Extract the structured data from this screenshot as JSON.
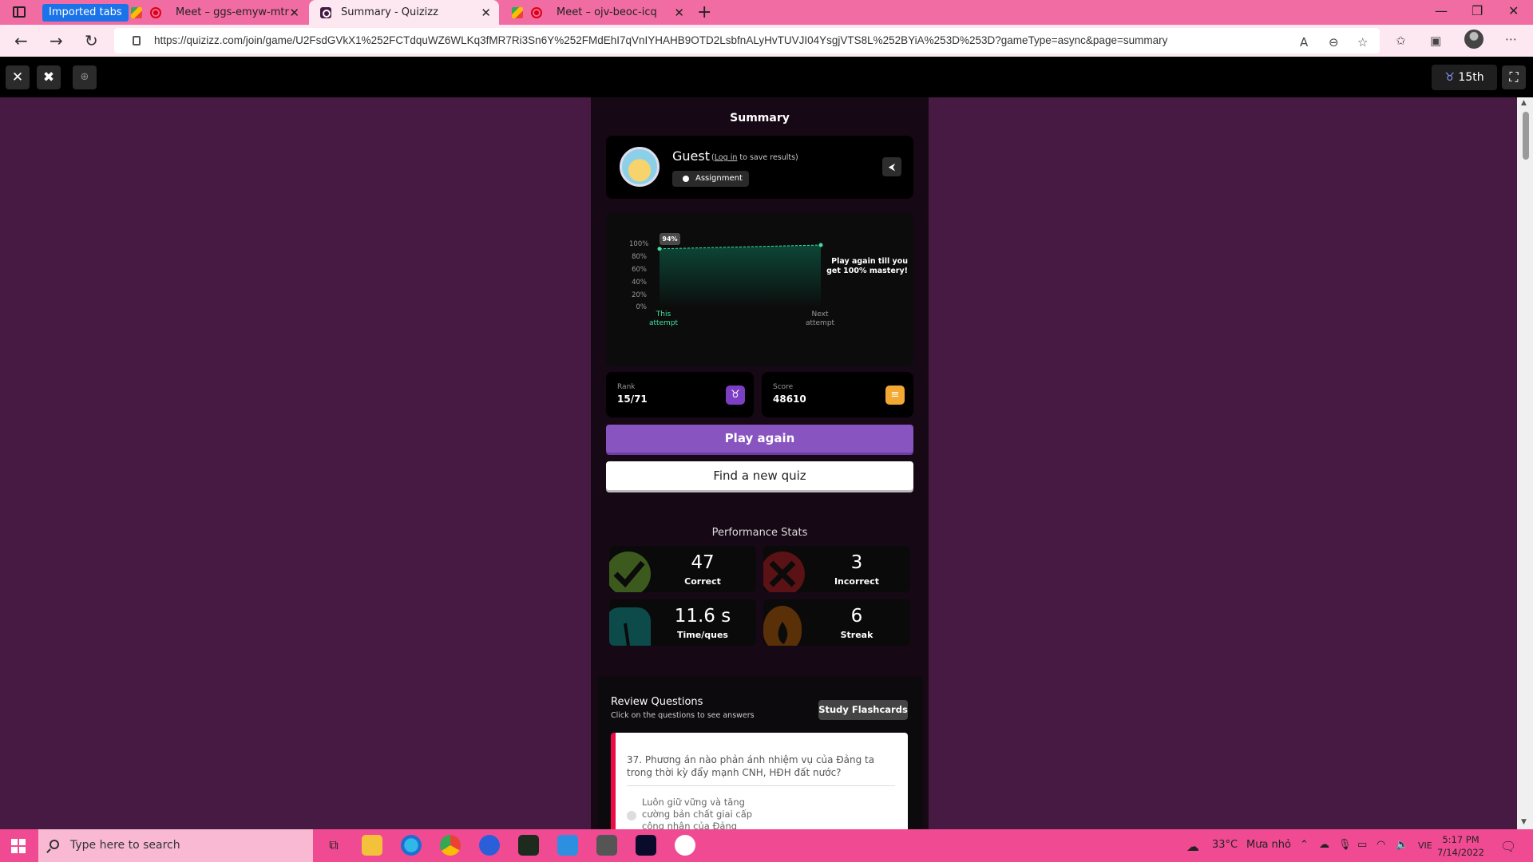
{
  "browser": {
    "imported_tabs": "Imported tabs",
    "tabs": [
      {
        "title": "Meet – ggs-emyw-mtr"
      },
      {
        "title": "Summary - Quizizz"
      },
      {
        "title": "Meet – ojv-beoc-icq"
      }
    ],
    "url": "https://quizizz.com/join/game/U2FsdGVkX1%252FCTdquWZ6WLKq3fMR7Ri3Sn6Y%252FMdEhI7qVnIYHAHB9OTD2LsbfnALyHvTUVJI04YsgjVTS8L%252BYiA%253D%253D?gameType=async&page=summary"
  },
  "appbar": {
    "rank_badge": "15th"
  },
  "summary": {
    "title": "Summary",
    "user": {
      "name": "Guest",
      "login_prefix": "(",
      "login_link": "Log in",
      "login_suffix": " to save results)",
      "mode": "Assignment"
    },
    "chart": {
      "badge": "94%",
      "yticks": [
        "100%",
        "80%",
        "60%",
        "40%",
        "20%",
        "0%"
      ],
      "x_this_1": "This",
      "x_this_2": "attempt",
      "x_next_1": "Next",
      "x_next_2": "attempt",
      "mastery_1": "Play again till you",
      "mastery_2": "get 100% mastery!"
    },
    "rank": {
      "label": "Rank",
      "value": "15/71"
    },
    "score": {
      "label": "Score",
      "value": "48610"
    },
    "play_again": "Play again",
    "find_quiz": "Find a new quiz"
  },
  "chart_data": {
    "type": "line",
    "categories": [
      "This attempt",
      "Next attempt"
    ],
    "values": [
      94,
      100
    ],
    "ylim": [
      0,
      100
    ],
    "yticks": [
      "0%",
      "20%",
      "40%",
      "60%",
      "80%",
      "100%"
    ]
  },
  "performance": {
    "title": "Performance Stats",
    "correct": {
      "value": "47",
      "label": "Correct"
    },
    "incorrect": {
      "value": "3",
      "label": "Incorrect"
    },
    "time": {
      "value": "11.6 s",
      "label": "Time/ques"
    },
    "streak": {
      "value": "6",
      "label": "Streak"
    }
  },
  "review": {
    "title": "Review Questions",
    "subtitle": "Click on the questions to see answers",
    "flashcards": "Study Flashcards",
    "question": "37.   Phương án nào phản ánh nhiệm vụ của Đảng ta trong thời kỳ đẩy mạnh CNH, HĐH đất nước?",
    "answer": "Luôn giữ vững và tăng cường bản chất giai cấp công nhân của Đảng"
  },
  "taskbar": {
    "search_placeholder": "Type here to search",
    "weather": "33°C",
    "weather_desc": "Mưa nhỏ",
    "lang": "VIE",
    "time": "5:17 PM",
    "date": "7/14/2022"
  }
}
